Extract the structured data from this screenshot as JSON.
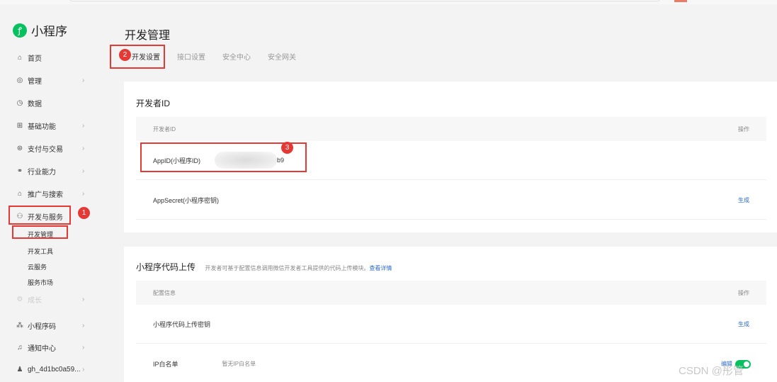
{
  "brand": {
    "name": "小程序",
    "logo_glyph": "ꝭ"
  },
  "sidebar": {
    "items": [
      {
        "icon": "home-icon",
        "glyph": "⌂",
        "label": "首页"
      },
      {
        "icon": "settings-icon",
        "glyph": "◎",
        "label": "管理",
        "chevron": "›"
      },
      {
        "icon": "clock-icon",
        "glyph": "◷",
        "label": "数据"
      },
      {
        "icon": "grid-icon",
        "glyph": "⊞",
        "label": "基础功能",
        "chevron": "›"
      },
      {
        "icon": "payment-icon",
        "glyph": "⊛",
        "label": "支付与交易",
        "chevron": "›"
      },
      {
        "icon": "industry-icon",
        "glyph": "⚭",
        "label": "行业能力",
        "chevron": "›"
      },
      {
        "icon": "promote-icon",
        "glyph": "⌂",
        "label": "推广与搜索",
        "chevron": "›"
      },
      {
        "icon": "dev-service-icon",
        "glyph": "⚇",
        "label": "开发与服务"
      },
      {
        "icon": "growth-icon",
        "glyph": "⚙",
        "label": "成长",
        "chevron": "›"
      },
      {
        "icon": "qrcode-icon",
        "glyph": "⁂",
        "label": "小程序码",
        "chevron": "›"
      },
      {
        "icon": "bell-icon",
        "glyph": "♫",
        "label": "通知中心",
        "chevron": "›"
      },
      {
        "icon": "user-icon",
        "glyph": "♟",
        "label": "gh_4d1bc0a59...",
        "chevron": "›"
      }
    ],
    "sub_items": [
      "开发管理",
      "开发工具",
      "云服务",
      "服务市场"
    ]
  },
  "header": {
    "title": "开发管理",
    "tabs": [
      "开发设置",
      "接口设置",
      "安全中心",
      "安全网关"
    ]
  },
  "dev_id_card": {
    "title": "开发者ID",
    "col_id": "开发者ID",
    "col_op": "操作",
    "appid_label": "AppID(小程序ID)",
    "appid_tail": "b9",
    "secret_label": "AppSecret(小程序密钥)",
    "secret_action": "生成"
  },
  "upload_card": {
    "title": "小程序代码上传",
    "desc": "开发者可基于配置信息调用微信开发者工具提供的代码上传模块。",
    "desc_link": "查看详情",
    "col_config": "配置信息",
    "col_op": "操作",
    "key_label": "小程序代码上传密钥",
    "key_action": "生成",
    "ip_label": "IP白名单",
    "ip_hint": "暂无IP白名单",
    "ip_action": "编辑"
  },
  "annotations": {
    "badge1": "1",
    "badge2": "2",
    "badge3": "3"
  },
  "watermark": "CSDN @彤管"
}
